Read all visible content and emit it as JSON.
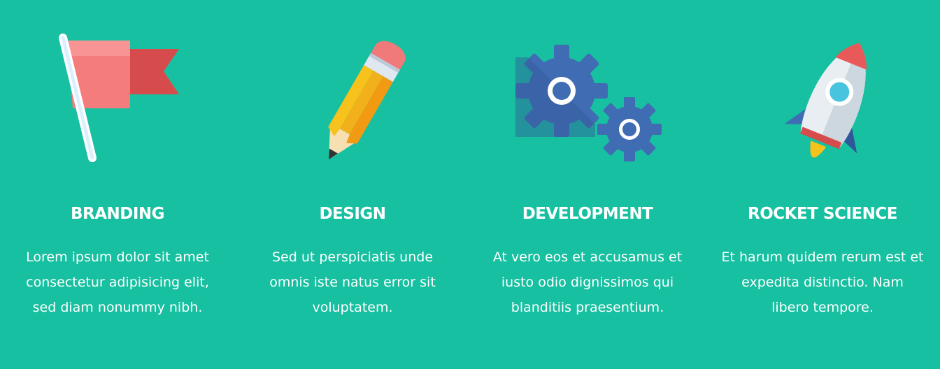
{
  "features": [
    {
      "icon": "flag-icon",
      "title": "BRANDING",
      "text": "Lorem ipsum dolor sit amet consectetur adipisicing elit, sed diam nonummy nibh."
    },
    {
      "icon": "pencil-icon",
      "title": "DESIGN",
      "text": "Sed ut perspiciatis unde omnis iste natus error sit voluptatem."
    },
    {
      "icon": "gears-icon",
      "title": "DEVELOPMENT",
      "text": "At vero eos et accusamus et iusto odio dignissimos qui blanditiis praesentium."
    },
    {
      "icon": "rocket-icon",
      "title": "ROCKET SCIENCE",
      "text": "Et harum quidem rerum est et expedita distinctio. Nam libero tempore."
    }
  ],
  "colors": {
    "background": "#17c0a0",
    "text": "#ffffff",
    "flag_light": "#f47c7c",
    "flag_dark": "#d64b4b",
    "pencil_yellow": "#f6c21b",
    "pencil_orange": "#f29a12",
    "gear_blue": "#3f6cb3",
    "rocket_body": "#e8eef2",
    "rocket_accent": "#48c4df"
  }
}
